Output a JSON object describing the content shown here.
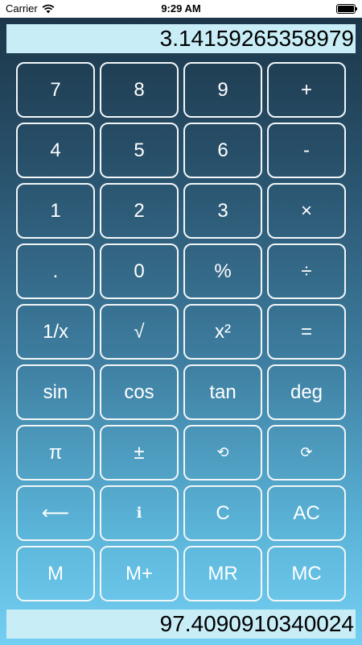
{
  "status_bar": {
    "carrier": "Carrier",
    "time": "9:29 AM"
  },
  "display": {
    "main_value": "3.14159265358979",
    "memory_value": "97.4090910340024"
  },
  "keypad": {
    "rows": [
      [
        {
          "label": "7",
          "name": "key-7"
        },
        {
          "label": "8",
          "name": "key-8"
        },
        {
          "label": "9",
          "name": "key-9"
        },
        {
          "label": "+",
          "name": "add-button"
        }
      ],
      [
        {
          "label": "4",
          "name": "key-4"
        },
        {
          "label": "5",
          "name": "key-5"
        },
        {
          "label": "6",
          "name": "key-6"
        },
        {
          "label": "-",
          "name": "subtract-button"
        }
      ],
      [
        {
          "label": "1",
          "name": "key-1"
        },
        {
          "label": "2",
          "name": "key-2"
        },
        {
          "label": "3",
          "name": "key-3"
        },
        {
          "label": "×",
          "name": "multiply-button"
        }
      ],
      [
        {
          "label": ".",
          "name": "decimal-point-button"
        },
        {
          "label": "0",
          "name": "key-0"
        },
        {
          "label": "%",
          "name": "percent-button"
        },
        {
          "label": "÷",
          "name": "divide-button"
        }
      ],
      [
        {
          "label": "1/x",
          "name": "reciprocal-button"
        },
        {
          "label": "√",
          "name": "square-root-button"
        },
        {
          "label": "x²",
          "name": "square-button"
        },
        {
          "label": "=",
          "name": "equals-button"
        }
      ],
      [
        {
          "label": "sin",
          "name": "sin-button"
        },
        {
          "label": "cos",
          "name": "cos-button"
        },
        {
          "label": "tan",
          "name": "tan-button"
        },
        {
          "label": "deg",
          "name": "deg-button"
        }
      ],
      [
        {
          "label": "π",
          "name": "pi-button"
        },
        {
          "label": "±",
          "name": "plus-minus-button"
        },
        {
          "label": "⟲",
          "name": "undo-button",
          "small": true
        },
        {
          "label": "⟳",
          "name": "redo-button",
          "small": true
        }
      ],
      [
        {
          "label": "⟵",
          "name": "backspace-button"
        },
        {
          "label": "ℹ",
          "name": "info-button",
          "small": true
        },
        {
          "label": "C",
          "name": "clear-button"
        },
        {
          "label": "AC",
          "name": "all-clear-button"
        }
      ],
      [
        {
          "label": "M",
          "name": "memory-store-button"
        },
        {
          "label": "M+",
          "name": "memory-add-button"
        },
        {
          "label": "MR",
          "name": "memory-recall-button"
        },
        {
          "label": "MC",
          "name": "memory-clear-button"
        }
      ]
    ]
  }
}
